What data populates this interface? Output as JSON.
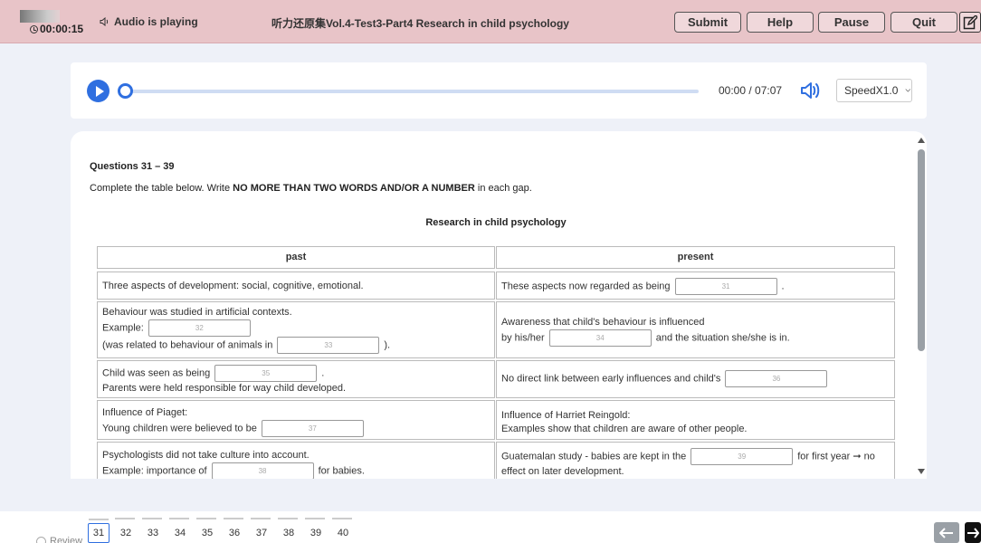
{
  "header": {
    "timer": "00:00:15",
    "audio_status": "Audio is playing",
    "title": "听力还原集Vol.4-Test3-Part4 Research in child psychology",
    "buttons": {
      "submit": "Submit",
      "help": "Help",
      "pause": "Pause",
      "quit": "Quit"
    }
  },
  "player": {
    "time": "00:00 / 07:07",
    "speed": "SpeedX1.0"
  },
  "content": {
    "heading": "Questions 31 – 39",
    "instruction_pre": "Complete the table below. Write ",
    "instruction_bold": "NO MORE THAN TWO WORDS AND/OR A NUMBER",
    "instruction_post": " in each gap.",
    "table_title": "Research in child psychology",
    "col_past": "past",
    "col_present": "present",
    "rows": [
      {
        "past": "Three aspects of development: social, cognitive, emotional.",
        "present_pre": "These aspects now regarded as being",
        "present_gap": "31",
        "present_post": "."
      },
      {
        "past_l1": "Behaviour was studied in artificial contexts.",
        "past_l2": "Example:",
        "past_gap1": "32",
        "past_l3": "(was related to behaviour of animals in",
        "past_gap2": "33",
        "past_l3_post": ").",
        "present_l1": "Awareness that child's behaviour is influenced",
        "present_l2_pre": "by his/her",
        "present_gap": "34",
        "present_l2_post": "and the situation she/she is in."
      },
      {
        "past_l1": "Child was seen as being",
        "past_gap": "35",
        "past_l1_post": ".",
        "past_l2": "Parents were held responsible for way child developed.",
        "present_pre": "No direct link between early influences and child's",
        "present_gap": "36"
      },
      {
        "past_l1": "Influence of Piaget:",
        "past_l2": "Young children were believed to be",
        "past_gap": "37",
        "present_l1": "Influence of Harriet Reingold:",
        "present_l2": "Examples show that children are aware of other people."
      },
      {
        "past_l1": "Psychologists did not take culture into account.",
        "past_l2": "Example: importance of",
        "past_gap": "38",
        "past_l2_post": "for babies.",
        "present_l1_pre": "Guatemalan study - babies are kept in the",
        "present_gap": "39",
        "present_l1_post": "for first year ➞ no",
        "present_l2": "effect on later development."
      }
    ]
  },
  "footer": {
    "review": "Review",
    "questions": [
      "31",
      "32",
      "33",
      "34",
      "35",
      "36",
      "37",
      "38",
      "39",
      "40"
    ],
    "active": "31"
  },
  "colors": {
    "header_bg": "#e8c4c8",
    "accent": "#2f6fe0",
    "page_bg": "#eef1f8"
  }
}
